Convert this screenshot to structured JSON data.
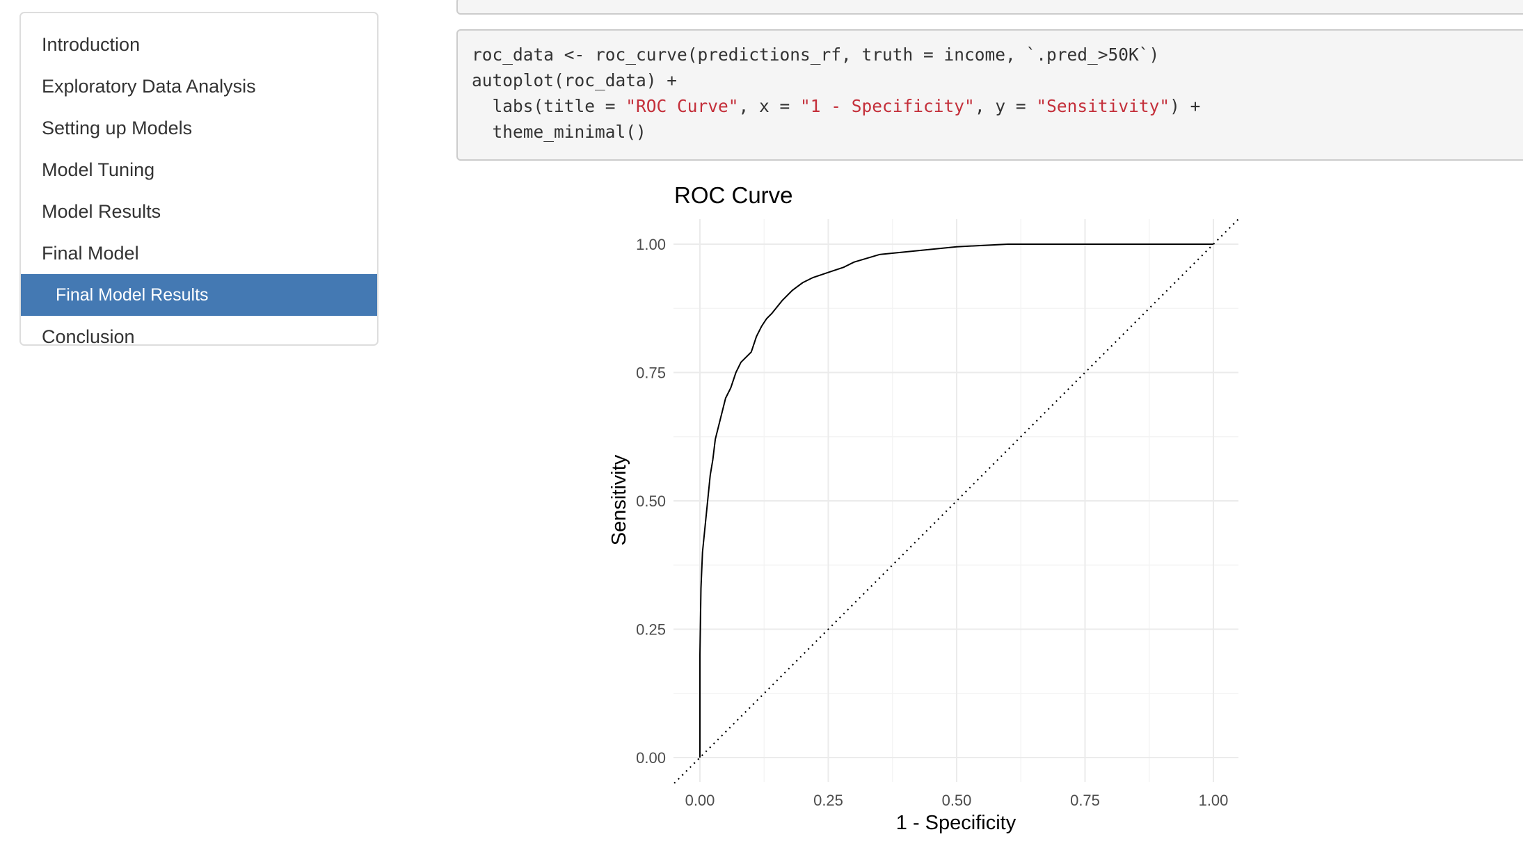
{
  "toc": {
    "items": [
      {
        "label": "Introduction",
        "active": false,
        "sub": false
      },
      {
        "label": "Exploratory Data Analysis",
        "active": false,
        "sub": false
      },
      {
        "label": "Setting up Models",
        "active": false,
        "sub": false
      },
      {
        "label": "Model Tuning",
        "active": false,
        "sub": false
      },
      {
        "label": "Model Results",
        "active": false,
        "sub": false
      },
      {
        "label": "Final Model",
        "active": false,
        "sub": false
      },
      {
        "label": "Final Model Results",
        "active": true,
        "sub": true
      },
      {
        "label": "Conclusion",
        "active": false,
        "sub": false
      }
    ],
    "active_color": "#4479b3"
  },
  "code": {
    "line1": "roc_data <- roc_curve(predictions_rf, truth = income, `.pred_>50K`)",
    "line2": "autoplot(roc_data) +",
    "line3_a": "  labs(title = ",
    "line3_s1": "\"ROC Curve\"",
    "line3_b": ", x = ",
    "line3_s2": "\"1 - Specificity\"",
    "line3_c": ", y = ",
    "line3_s3": "\"Sensitivity\"",
    "line3_d": ") +",
    "line4": "  theme_minimal()",
    "string_color": "#c42f3a"
  },
  "chart_data": {
    "type": "line",
    "title": "ROC Curve",
    "xlabel": "1 - Specificity",
    "ylabel": "Sensitivity",
    "xlim": [
      0,
      1
    ],
    "ylim": [
      0,
      1
    ],
    "x_ticks": [
      "0.00",
      "0.25",
      "0.50",
      "0.75",
      "1.00"
    ],
    "y_ticks": [
      "0.00",
      "0.25",
      "0.50",
      "0.75",
      "1.00"
    ],
    "grid": true,
    "series": [
      {
        "style": "solid",
        "x": [
          0,
          0,
          0.002,
          0.005,
          0.01,
          0.015,
          0.02,
          0.025,
          0.03,
          0.04,
          0.05,
          0.06,
          0.07,
          0.08,
          0.1,
          0.11,
          0.12,
          0.13,
          0.14,
          0.16,
          0.18,
          0.2,
          0.22,
          0.25,
          0.28,
          0.3,
          0.35,
          0.4,
          0.5,
          0.6,
          0.8,
          1.0
        ],
        "y": [
          0,
          0.2,
          0.33,
          0.4,
          0.45,
          0.5,
          0.55,
          0.58,
          0.62,
          0.66,
          0.7,
          0.72,
          0.75,
          0.77,
          0.79,
          0.82,
          0.84,
          0.855,
          0.865,
          0.89,
          0.91,
          0.925,
          0.935,
          0.945,
          0.955,
          0.965,
          0.98,
          0.985,
          0.995,
          1.0,
          1.0,
          1.0
        ]
      },
      {
        "style": "dotted",
        "x": [
          -0.05,
          1.05
        ],
        "y": [
          -0.05,
          1.05
        ]
      }
    ]
  }
}
